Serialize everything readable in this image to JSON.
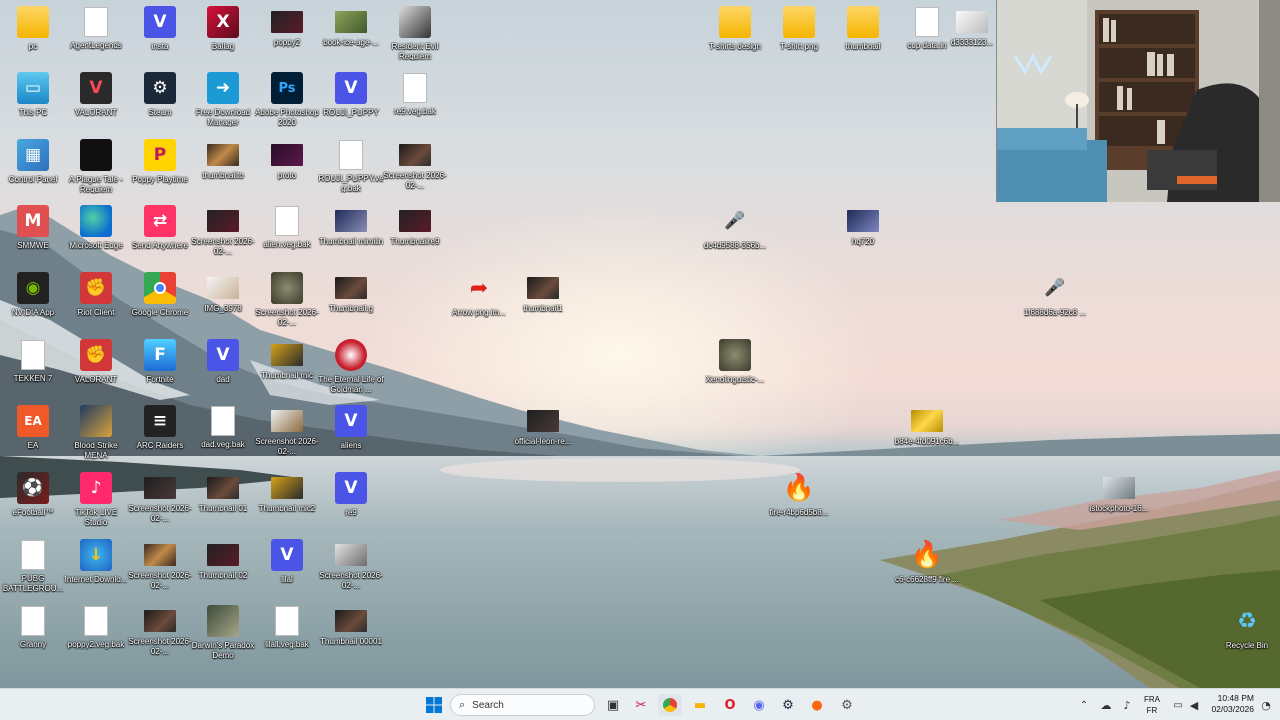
{
  "desktop": {
    "col1": [
      "pc",
      "This PC",
      "Control Panel",
      "SMMWE",
      "NVIDIA App",
      "TEKKEN 7",
      "EA",
      "eFootball™",
      "PUBG BATTLEGROU...",
      "Granny"
    ],
    "col2": [
      "AgentLegends",
      "VALORANT",
      "A Plague Tale - Requiem",
      "Microsoft Edge",
      "Riot Client",
      "VALORANT",
      "Blood Strike MENA",
      "TikTok LIVE Studio",
      "Internet Downlo...",
      "poppy2.veg.bak"
    ],
    "col3": [
      "insta",
      "Steam",
      "Poppy Playtime",
      "Send Anywhere",
      "Google Chrome",
      "Fortnite",
      "ARC Raiders",
      "Screenshot 2026-02-...",
      "Screenshot 2026-02-...",
      "Screenshot 2026-02-..."
    ],
    "col4": [
      "Ballag",
      "Free Download Manager",
      "thumbnailto",
      "Screenshot 2026-02-...",
      "IMG_3978",
      "dad",
      "dad.veg.bak",
      "Thumbnail 01",
      "Thumbnail 02",
      "Darwin's Paradox Demo"
    ],
    "col5": [
      "poppy2",
      "Adobe Photoshop 2020",
      "proto",
      "alien.veg.bak",
      "Screenshot 2026-02-...",
      "Thumbnail mic",
      "Screenshot 2026-02-...",
      "Thumbnail mic2",
      "lilal",
      "lilall.veg.bak"
    ],
    "col6": [
      "book-ice-age-...",
      "ROUJI_PUPPY",
      "ROUJI_PUPPY.veg.bak",
      "Thumbnail mimilin",
      "Thumbnail.g",
      "The Eternal Life of Goldman ...",
      "aliens",
      "re9",
      "Screenshot 2026-02-...",
      "Thumbnail 00001"
    ],
    "col7": [
      "Resident Evil Requiem",
      "re9.veg.bak",
      "Screenshot 2026-02-...",
      "Thumbnailre9"
    ],
    "loose": {
      "arrow": "Arrow png im...",
      "thumbnail1": "thumbnail1",
      "official": "official-leon-re...",
      "xeno": "Xenolinguistic-...",
      "dc": "dc4d9588-356b...",
      "hq": "hq720",
      "gold": "b84e-4fd091c6b...",
      "fire1": "fire-r4bp6d5b8...",
      "fire2": "c6-c6628ff9 fire ...",
      "mic2": "1f688d6a-92c8 ...",
      "istock": "istockphoto-16...",
      "recycle": "Recycle Bin"
    },
    "topright": [
      "T-shirts design",
      "T-shirt png",
      "thumbnail",
      "cup data.in",
      "d3333123..."
    ]
  },
  "taskbar": {
    "search_placeholder": "Search",
    "lang_line1": "FRA",
    "lang_line2": "FR",
    "time": "10:48 PM",
    "date": "02/03/2026"
  },
  "colors": {
    "taskbar_bg": "#e9eef1",
    "windows_blue": "#0078d4",
    "label_text": "#ffffff"
  }
}
